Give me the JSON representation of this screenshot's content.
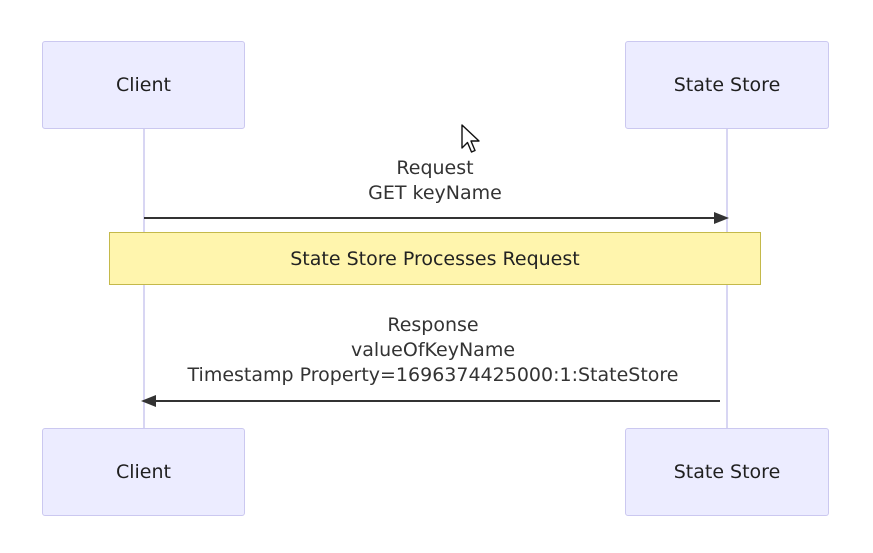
{
  "participants": {
    "client": "Client",
    "state_store": "State Store"
  },
  "messages": {
    "request": {
      "line1": "Request",
      "line2": "GET keyName"
    },
    "note": "State Store Processes Request",
    "response": {
      "line1": "Response",
      "line2": "valueOfKeyName",
      "line3": "Timestamp Property=1696374425000:1:StateStore"
    }
  },
  "colors": {
    "actor_fill": "#ececff",
    "actor_border": "#cbc8f0",
    "note_fill": "#fff5ad",
    "note_border": "#c4b94a",
    "arrow": "#333333"
  },
  "icons": {
    "cursor": "mouse-pointer-icon"
  }
}
